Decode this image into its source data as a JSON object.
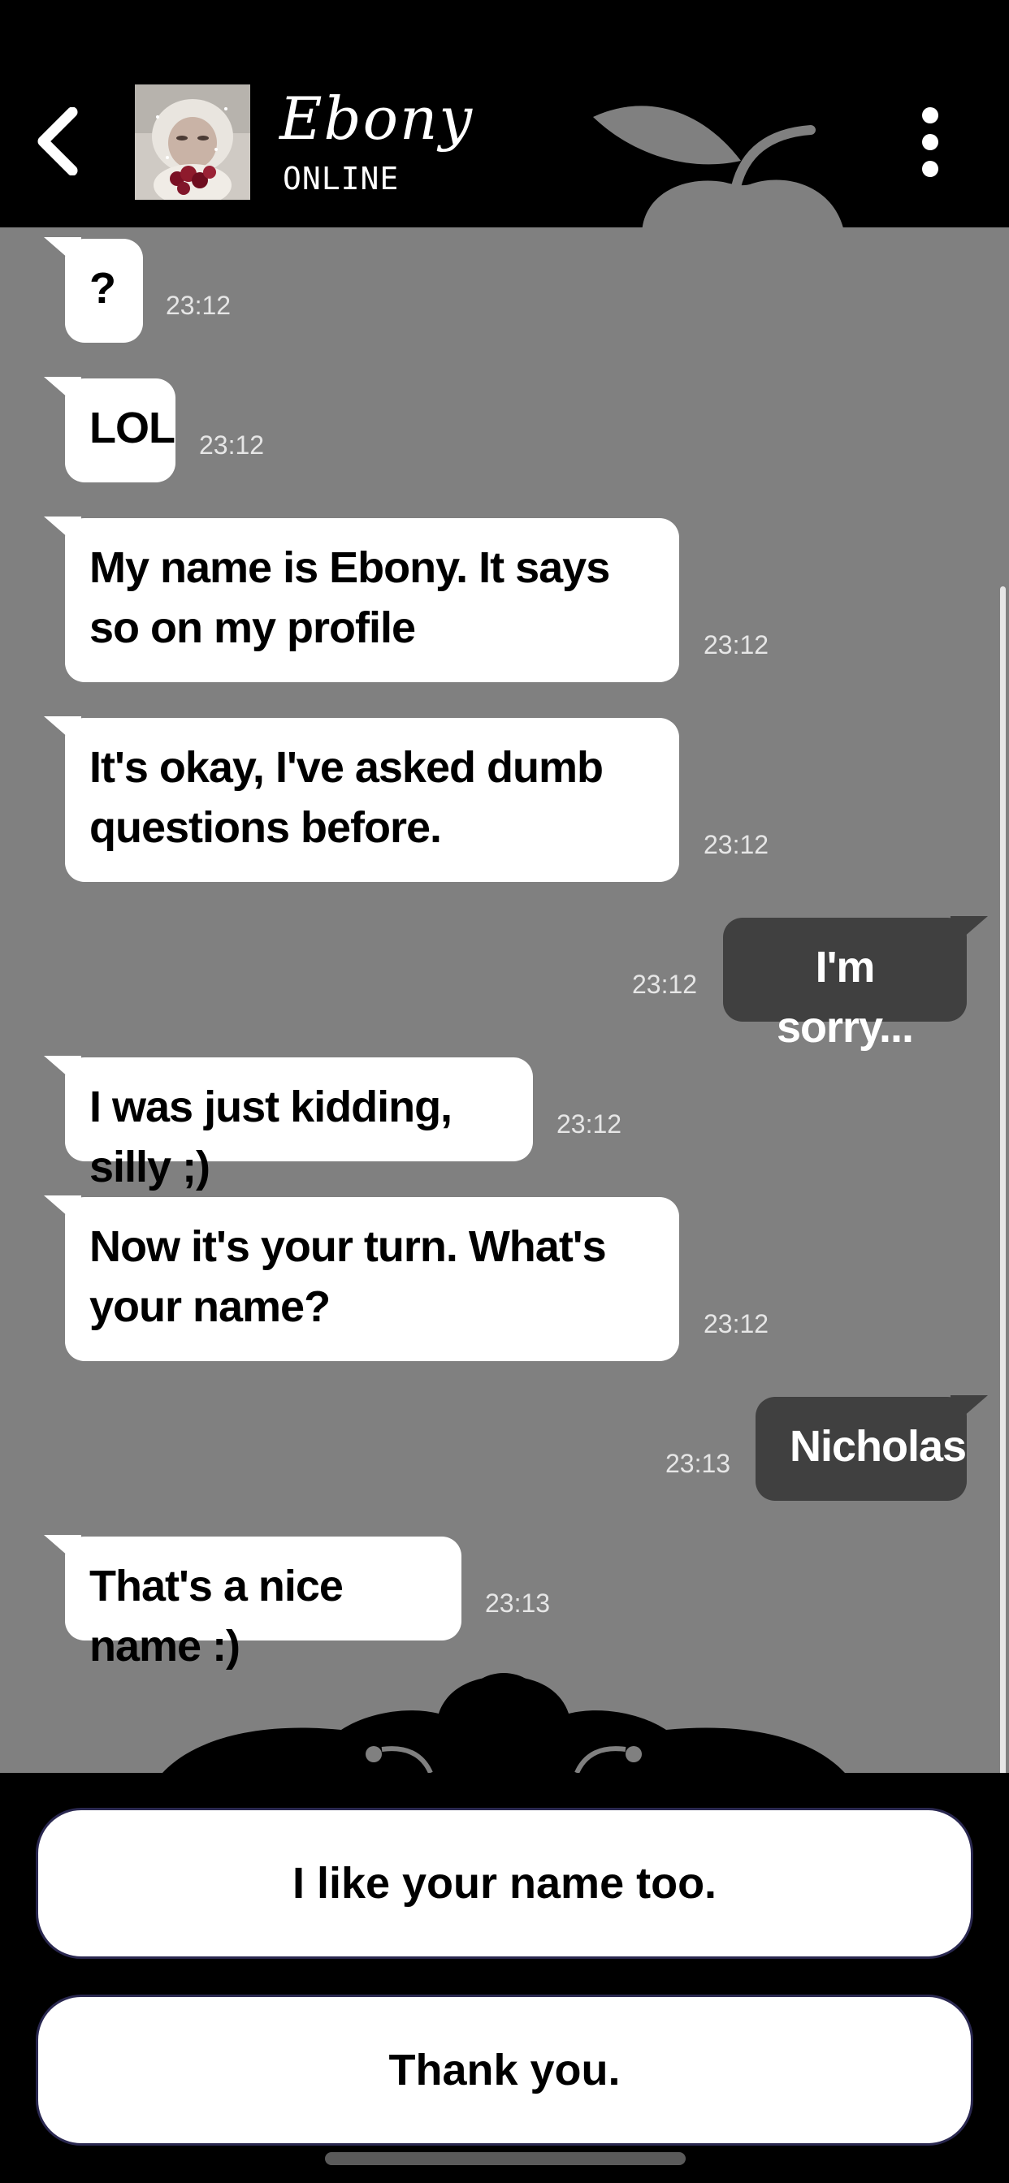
{
  "header": {
    "contact_name": "Ebony",
    "status": "ONLINE",
    "back_icon": "chevron-left-icon",
    "more_icon": "more-vertical-icon"
  },
  "messages": [
    {
      "side": "in",
      "text": "?",
      "time": "23:12"
    },
    {
      "side": "in",
      "text": "LOL",
      "time": "23:12"
    },
    {
      "side": "in",
      "text": "My name is Ebony. It says so on my profile",
      "time": "23:12"
    },
    {
      "side": "in",
      "text": "It's okay, I've asked dumb questions before.",
      "time": "23:12"
    },
    {
      "side": "out",
      "text": "I'm sorry...",
      "time": "23:12"
    },
    {
      "side": "in",
      "text": "I was just kidding, silly ;)",
      "time": "23:12"
    },
    {
      "side": "in",
      "text": "Now it's your turn. What's your name?",
      "time": "23:12"
    },
    {
      "side": "out",
      "text": "Nicholas",
      "time": "23:13"
    },
    {
      "side": "in",
      "text": "That's a nice name :)",
      "time": "23:13"
    }
  ],
  "reply_options": [
    {
      "label": "I like your name too."
    },
    {
      "label": "Thank you."
    }
  ],
  "colors": {
    "chat_background": "#808080",
    "incoming_bubble": "#ffffff",
    "outgoing_bubble": "#404040",
    "chrome": "#000000"
  }
}
